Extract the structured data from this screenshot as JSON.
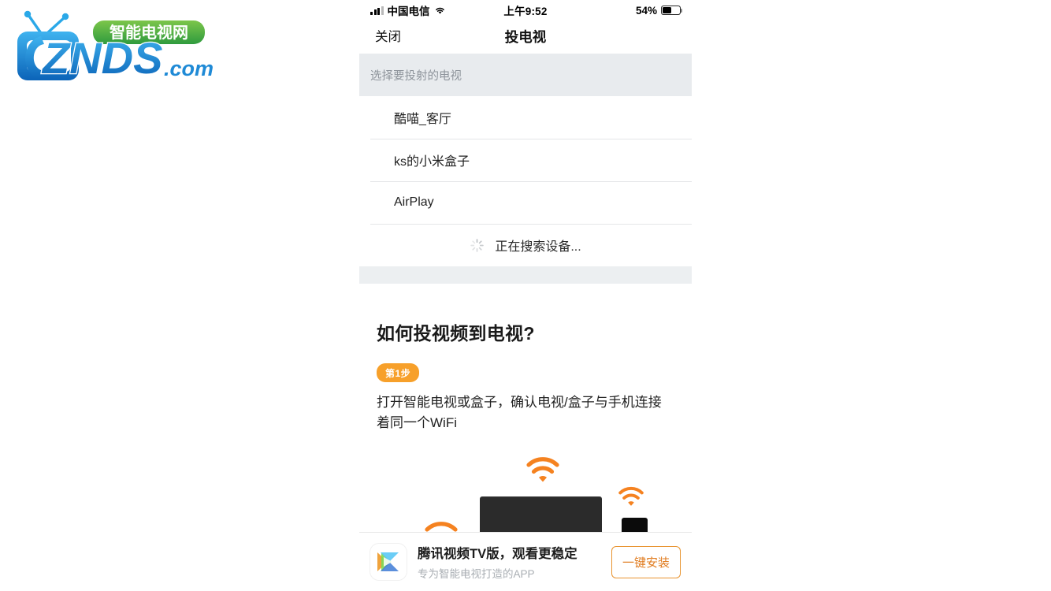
{
  "watermark": {
    "brand": "ZNDS",
    "domain": ".com",
    "tagline": "智能电视网"
  },
  "status_bar": {
    "carrier": "中国电信",
    "time": "上午9:52",
    "battery_percent": "54%",
    "battery_level": 54,
    "signal_icon": "signal-bars-icon",
    "wifi_icon": "wifi-icon",
    "battery_icon": "battery-icon"
  },
  "nav": {
    "close_label": "关闭",
    "title": "投电视"
  },
  "section": {
    "header": "选择要投射的电视"
  },
  "devices": [
    {
      "name": "酷喵_客厅"
    },
    {
      "name": "ks的小米盒子"
    },
    {
      "name": "AirPlay"
    }
  ],
  "searching": {
    "label": "正在搜索设备...",
    "spinner_icon": "loading-spinner-icon"
  },
  "howto": {
    "title": "如何投视频到电视?",
    "step_badge": "第1步",
    "step_text": "打开智能电视或盒子，确认电视/盒子与手机连接着同一个WiFi"
  },
  "illustration": {
    "wifi_icon": "wifi-icon",
    "tv_icon": "tv-icon",
    "box_icon": "set-top-box-icon",
    "accent_color": "#f58220"
  },
  "ad_banner": {
    "icon": "tencent-video-icon",
    "title": "腾讯视频TV版，观看更稳定",
    "subtitle": "专为智能电视打造的APP",
    "button_label": "一键安装",
    "button_color": "#e8932f"
  }
}
